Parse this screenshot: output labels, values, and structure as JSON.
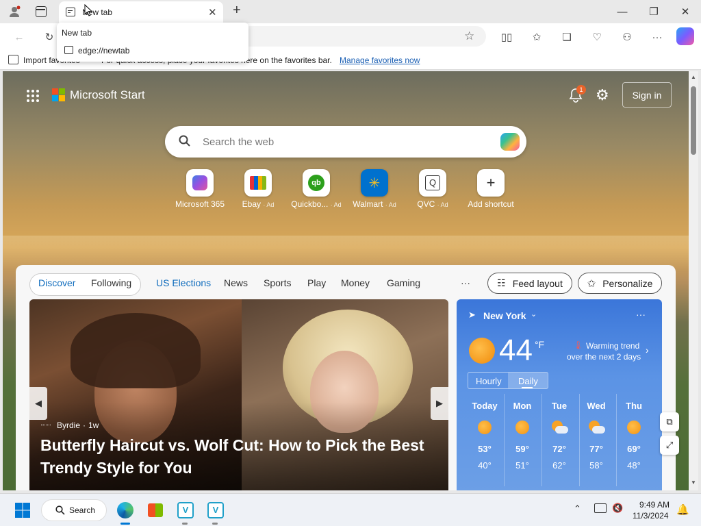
{
  "browser": {
    "tab": {
      "title": "New tab"
    },
    "tooltip": {
      "title": "New tab",
      "url": "edge://newtab"
    },
    "favorites_bar": {
      "import_label": "Import favorites",
      "hint_text": "For quick access, place your favorites here on the favorites bar.",
      "manage_link": "Manage favorites now"
    }
  },
  "start": {
    "brand": "Microsoft Start",
    "notification_count": "1",
    "sign_in": "Sign in",
    "search_placeholder": "Search the web",
    "shortcuts": [
      {
        "label": "Microsoft 365",
        "ad": ""
      },
      {
        "label": "Ebay",
        "ad": "· Ad"
      },
      {
        "label": "Quickbo...",
        "ad": "· Ad"
      },
      {
        "label": "Walmart",
        "ad": "· Ad"
      },
      {
        "label": "QVC",
        "ad": "· Ad"
      },
      {
        "label": "Add shortcut",
        "ad": ""
      }
    ],
    "nav": {
      "discover": "Discover",
      "following": "Following",
      "us_elections": "US Elections",
      "news": "News",
      "sports": "Sports",
      "play": "Play",
      "money": "Money",
      "gaming": "Gaming",
      "more": "···",
      "feed_layout": "Feed layout",
      "personalize": "Personalize"
    },
    "hero": {
      "source": "Byrdie",
      "age": "1w",
      "headline": "Butterfly Haircut vs. Wolf Cut: How to Pick the Best Trendy Style for You"
    },
    "weather": {
      "location": "New York",
      "temp": "44",
      "unit": "°F",
      "trend_line1": "Warming trend",
      "trend_line2": "over the next 2 days",
      "tab_hourly": "Hourly",
      "tab_daily": "Daily",
      "more": "···",
      "days": [
        {
          "day": "Today",
          "high": "53°",
          "low": "40°",
          "icon": "sun"
        },
        {
          "day": "Mon",
          "high": "59°",
          "low": "51°",
          "icon": "sun"
        },
        {
          "day": "Tue",
          "high": "72°",
          "low": "62°",
          "icon": "partly-cloudy"
        },
        {
          "day": "Wed",
          "high": "77°",
          "low": "58°",
          "icon": "partly-cloudy"
        },
        {
          "day": "Thu",
          "high": "69°",
          "low": "48°",
          "icon": "sun"
        }
      ]
    }
  },
  "taskbar": {
    "search_label": "Search",
    "time": "9:49 AM",
    "date": "11/3/2024"
  },
  "colors": {
    "accent": "#0f6cbd",
    "link": "#1a5fb4",
    "weather_bg": "#4a86e0"
  }
}
